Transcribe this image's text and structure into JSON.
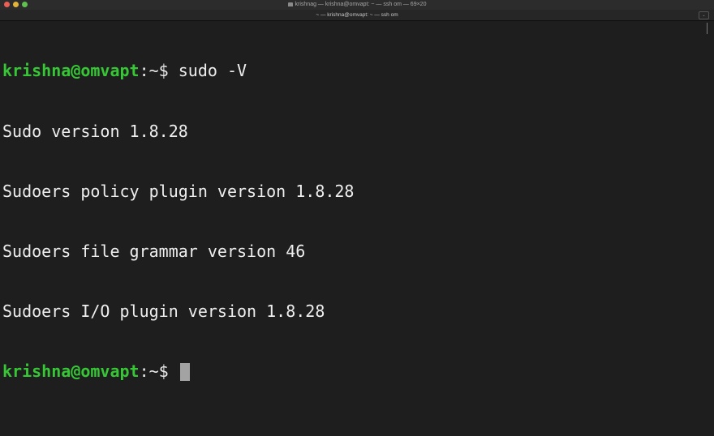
{
  "window": {
    "title": "krishnag — krishna@omvapt: ~ — ssh om — 69×20",
    "tab_title": "~ — krishna@omvapt: ~ — ssh om",
    "tab_menu_icon": "chevron-down-icon"
  },
  "terminal": {
    "prompt_user_host": "krishna@omvapt",
    "prompt_suffix": ":~$",
    "lines": [
      {
        "type": "prompt",
        "command": " sudo -V"
      },
      {
        "type": "output",
        "text": "Sudo version 1.8.28"
      },
      {
        "type": "output",
        "text": "Sudoers policy plugin version 1.8.28"
      },
      {
        "type": "output",
        "text": "Sudoers file grammar version 46"
      },
      {
        "type": "output",
        "text": "Sudoers I/O plugin version 1.8.28"
      },
      {
        "type": "prompt",
        "command": " "
      }
    ]
  },
  "colors": {
    "background": "#1e1e1e",
    "prompt_user": "#37c736",
    "text": "#eeeeee",
    "cursor": "#a3a3a3"
  }
}
